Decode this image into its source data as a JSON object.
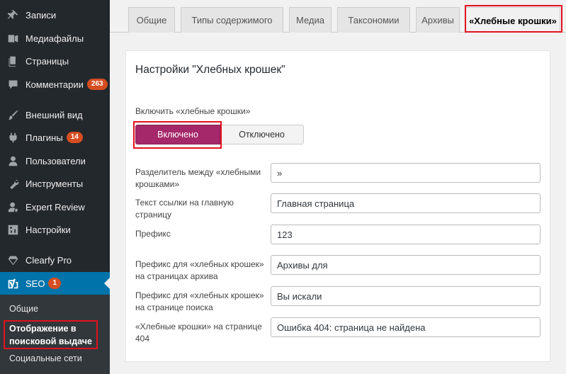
{
  "sidebar": {
    "items": [
      {
        "label": "Записи",
        "icon": "pin-icon"
      },
      {
        "label": "Медиафайлы",
        "icon": "media-icon"
      },
      {
        "label": "Страницы",
        "icon": "pages-icon"
      },
      {
        "label": "Комментарии",
        "icon": "comments-icon",
        "badge": "263"
      },
      {
        "label": "Внешний вид",
        "icon": "paintbrush-icon"
      },
      {
        "label": "Плагины",
        "icon": "plugin-icon",
        "badge": "14"
      },
      {
        "label": "Пользователи",
        "icon": "users-icon"
      },
      {
        "label": "Инструменты",
        "icon": "wrench-icon"
      },
      {
        "label": "Expert Review",
        "icon": "expert-review-icon"
      },
      {
        "label": "Настройки",
        "icon": "settings-icon"
      },
      {
        "label": "Clearfy Pro",
        "icon": "diamond-icon"
      },
      {
        "label": "SEO",
        "icon": "yoast-icon",
        "badge": "1"
      }
    ],
    "submenu": [
      {
        "label": "Общие"
      },
      {
        "label": "Отображение в поисковой выдаче"
      },
      {
        "label": "Социальные сети"
      }
    ]
  },
  "tabs": [
    {
      "label": "Общие"
    },
    {
      "label": "Типы содержимого"
    },
    {
      "label": "Медиа"
    },
    {
      "label": "Таксономии"
    },
    {
      "label": "Архивы"
    },
    {
      "label": "«Хлебные крошки»"
    }
  ],
  "panel": {
    "title": "Настройки \"Хлебных крошек\"",
    "toggle_label": "Включить «хлебные крошки»",
    "toggle_on": "Включено",
    "toggle_off": "Отключено",
    "fields": [
      {
        "label": "Разделитель между «хлебными крошками»",
        "value": "»"
      },
      {
        "label": "Текст ссылки на главную страницу",
        "value": "Главная страница"
      },
      {
        "label": "Префикс",
        "value": "123"
      },
      {
        "label": "Префикс для «хлебных крошек» на страницах архива",
        "value": "Архивы для"
      },
      {
        "label": "Префикс для «хлебных крошек» на странице поиска",
        "value": "Вы искали"
      },
      {
        "label": "«Хлебные крошки» на странице 404",
        "value": "Ошибка 404: страница не найдена"
      }
    ]
  },
  "colors": {
    "sidebar_bg": "#23282d",
    "active_bg": "#0073aa",
    "toggle_on_bg": "#a4286a",
    "highlight_border": "#e3111e",
    "badge_bg": "#d54e21"
  }
}
